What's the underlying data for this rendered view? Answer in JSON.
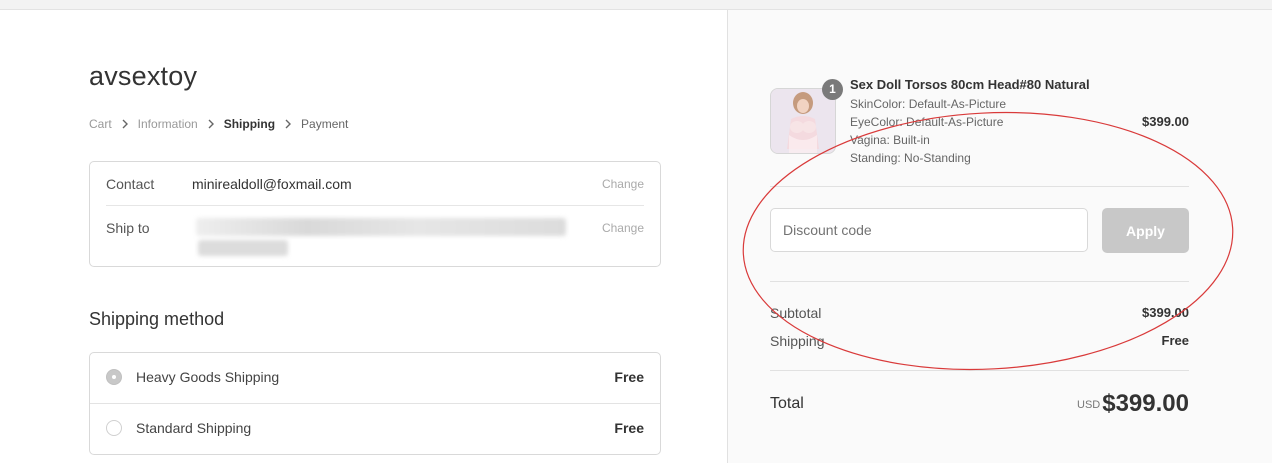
{
  "store": {
    "name": "avsextoy"
  },
  "breadcrumb": {
    "items": [
      {
        "label": "Cart"
      },
      {
        "label": "Information"
      },
      {
        "label": "Shipping"
      },
      {
        "label": "Payment"
      }
    ]
  },
  "review": {
    "contact": {
      "label": "Contact",
      "value": "minirealdoll@foxmail.com",
      "action": "Change"
    },
    "ship_to": {
      "label": "Ship to",
      "action": "Change"
    }
  },
  "shipping": {
    "title": "Shipping method",
    "options": [
      {
        "name": "Heavy Goods Shipping",
        "price": "Free",
        "selected": true
      },
      {
        "name": "Standard Shipping",
        "price": "Free",
        "selected": false
      }
    ]
  },
  "order": {
    "product": {
      "title": "Sex Doll Torsos 80cm Head#80 Natural",
      "quantity": "1",
      "variants": [
        "SkinColor: Default-As-Picture",
        "EyeColor: Default-As-Picture",
        "Vagina: Built-in",
        "Standing: No-Standing"
      ],
      "price": "$399.00"
    },
    "discount": {
      "placeholder": "Discount code",
      "button": "Apply"
    },
    "subtotal": {
      "label": "Subtotal",
      "value": "$399.00"
    },
    "shipping_line": {
      "label": "Shipping",
      "value": "Free"
    },
    "total": {
      "label": "Total",
      "currency": "USD",
      "value": "$399.00"
    }
  },
  "colors": {
    "annotation_circle": "#d93a3a",
    "sidebar_bg": "#fafafa",
    "apply_button_bg": "#c8c8c8"
  }
}
